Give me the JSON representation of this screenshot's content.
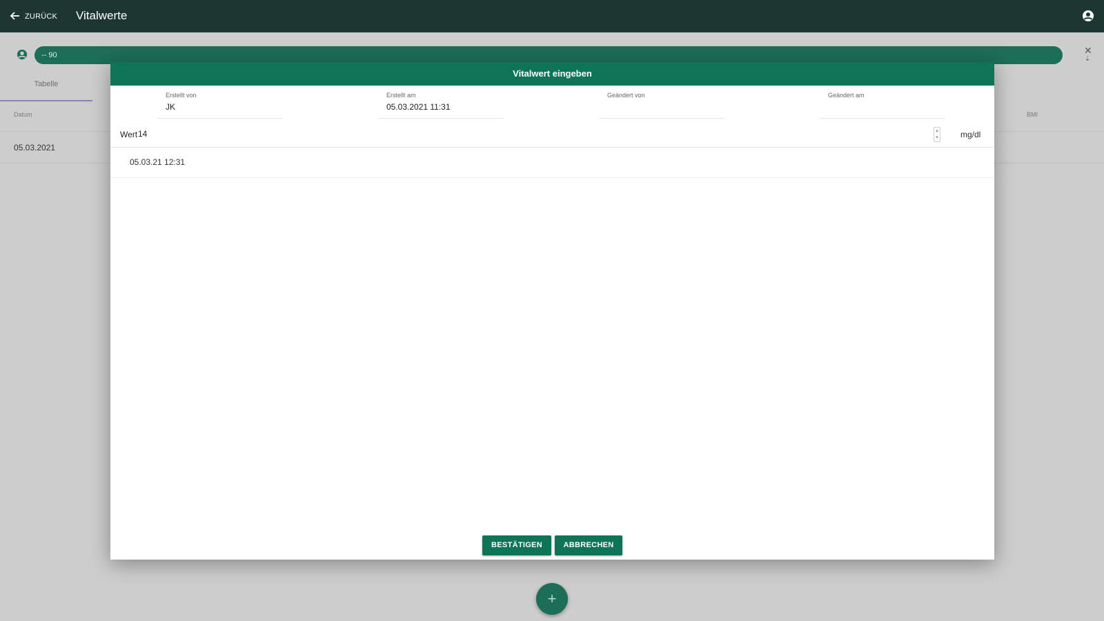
{
  "appbar": {
    "back_label": "ZURÜCK",
    "title": "Vitalwerte"
  },
  "background": {
    "patient_chip_text": "-- 90",
    "tab_label": "Tabelle",
    "columns": [
      "Datum",
      "BMI"
    ],
    "rows": [
      {
        "date": "05.03.2021"
      }
    ]
  },
  "modal": {
    "title": "Vitalwert eingeben",
    "meta": [
      {
        "label": "Erstellt von",
        "value": "JK"
      },
      {
        "label": "Erstellt am",
        "value": "05.03.2021 11:31"
      },
      {
        "label": "Geändert von",
        "value": ""
      },
      {
        "label": "Geändert am",
        "value": ""
      }
    ],
    "wert_label": "Wert",
    "wert_value": "14",
    "unit": "mg/dl",
    "datetime": "05.03.21 12:31",
    "confirm_label": "BESTÄTIGEN",
    "cancel_label": "ABBRECHEN"
  },
  "colors": {
    "appbar": "#1d3630",
    "accent": "#0f7457",
    "chip": "#1d6e58"
  }
}
